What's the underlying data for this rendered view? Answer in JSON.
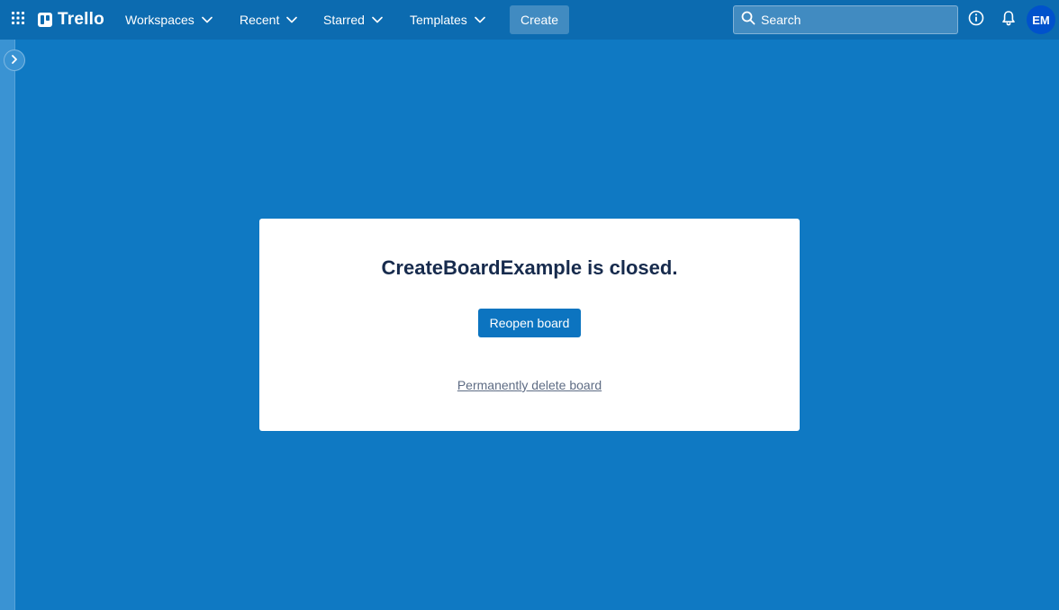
{
  "header": {
    "app_name": "Trello",
    "nav": [
      {
        "label": "Workspaces"
      },
      {
        "label": "Recent"
      },
      {
        "label": "Starred"
      },
      {
        "label": "Templates"
      }
    ],
    "create_label": "Create",
    "search": {
      "placeholder": "Search",
      "value": ""
    },
    "avatar_initials": "EM"
  },
  "icons": {
    "apps": "grid-icon",
    "search": "search-icon",
    "info": "info-icon",
    "notifications": "bell-icon",
    "sidebar_toggle": "chevron-right-icon",
    "nav_chevron": "chevron-down-icon"
  },
  "board_closed": {
    "message": "CreateBoardExample is closed.",
    "reopen_label": "Reopen board",
    "delete_label": "Permanently delete board"
  },
  "colors": {
    "background": "#0f79c3",
    "header": "#0c6bb0",
    "primary_button": "#0c74c0",
    "avatar": "#0052cc",
    "title_text": "#172b4d",
    "link_text": "#5e6c84"
  }
}
